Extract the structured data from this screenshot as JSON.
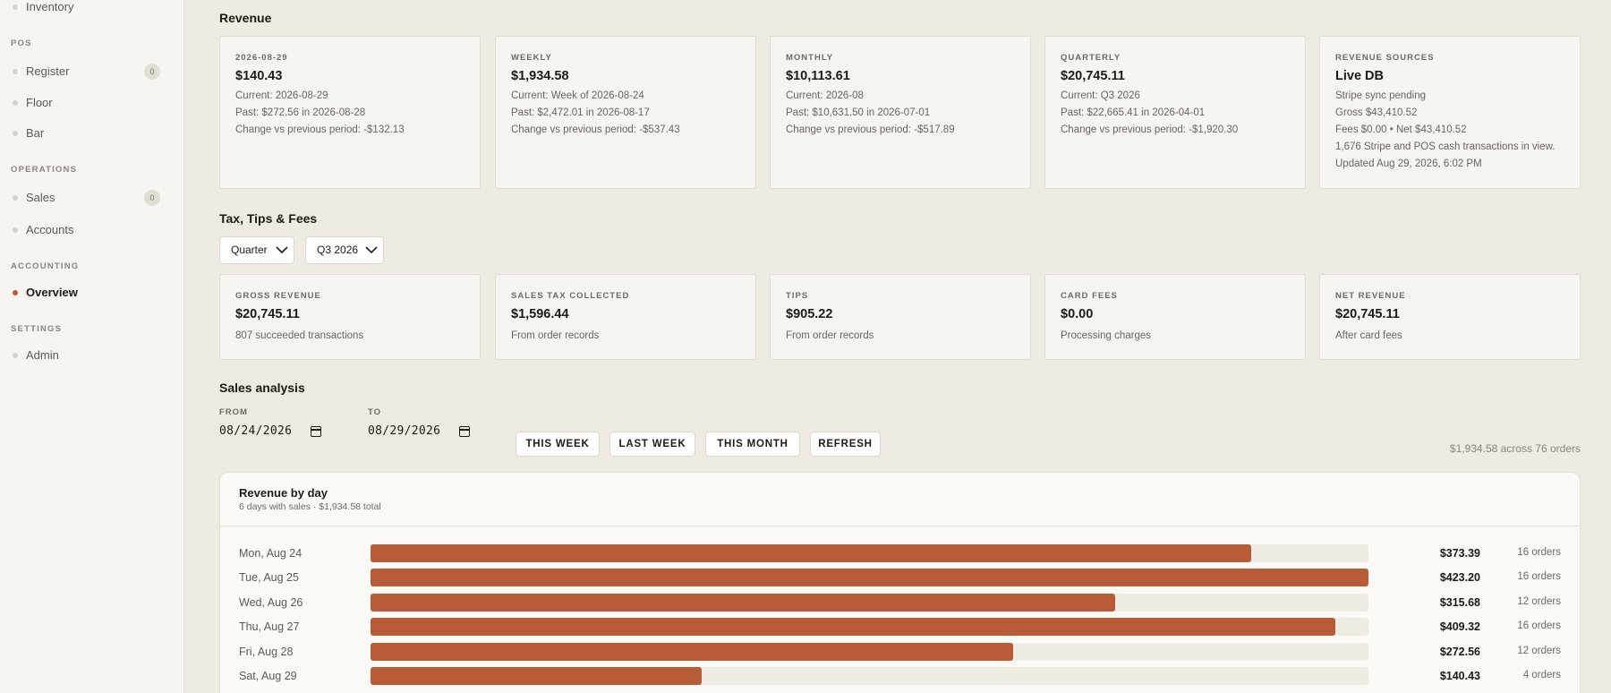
{
  "sidebar": {
    "items": [
      {
        "label": "Inventory",
        "active": false
      },
      {
        "section": "POS"
      },
      {
        "label": "Register",
        "count": "0",
        "active": false
      },
      {
        "label": "Floor",
        "active": false
      },
      {
        "label": "Bar",
        "active": false
      },
      {
        "section": "OPERATIONS"
      },
      {
        "label": "Sales",
        "count": "0",
        "active": false
      },
      {
        "label": "Accounts",
        "active": false
      },
      {
        "section": "ACCOUNTING"
      },
      {
        "label": "Overview",
        "active": true
      },
      {
        "section": "SETTINGS"
      },
      {
        "label": "Admin",
        "active": false
      }
    ]
  },
  "revenue": {
    "title": "Revenue",
    "cards": [
      {
        "kicker": "2026-08-29",
        "value": "$140.43",
        "lines": [
          "Current: 2026-08-29",
          "Past: $272.56 in 2026-08-28",
          "Change vs previous period: -$132.13"
        ]
      },
      {
        "kicker": "WEEKLY",
        "value": "$1,934.58",
        "lines": [
          "Current: Week of 2026-08-24",
          "Past: $2,472.01 in 2026-08-17",
          "Change vs previous period: -$537.43"
        ]
      },
      {
        "kicker": "MONTHLY",
        "value": "$10,113.61",
        "lines": [
          "Current: 2026-08",
          "Past: $10,631.50 in 2026-07-01",
          "Change vs previous period: -$517.89"
        ]
      },
      {
        "kicker": "QUARTERLY",
        "value": "$20,745.11",
        "lines": [
          "Current: Q3 2026",
          "Past: $22,665.41 in 2026-04-01",
          "Change vs previous period: -$1,920.30"
        ]
      },
      {
        "kicker": "REVENUE SOURCES",
        "value": "Live DB",
        "lines": [
          "Stripe sync pending",
          "Gross $43,410.52",
          "Fees $0.00 • Net $43,410.52",
          "1,676 Stripe and POS cash transactions in view.",
          "Updated Aug 29, 2026, 6:02 PM"
        ]
      }
    ]
  },
  "taxes": {
    "title": "Tax, Tips & Fees",
    "period_select": "Quarter",
    "quarter_select": "Q3 2026",
    "cards": [
      {
        "kicker": "GROSS REVENUE",
        "value": "$20,745.11",
        "note": "807 succeeded transactions"
      },
      {
        "kicker": "SALES TAX COLLECTED",
        "value": "$1,596.44",
        "note": "From order records"
      },
      {
        "kicker": "TIPS",
        "value": "$905.22",
        "note": "From order records"
      },
      {
        "kicker": "CARD FEES",
        "value": "$0.00",
        "note": "Processing charges"
      },
      {
        "kicker": "NET REVENUE",
        "value": "$20,745.11",
        "note": "After card fees"
      }
    ]
  },
  "analysis": {
    "title": "Sales analysis",
    "from_label": "FROM",
    "from_value": "08/24/2026",
    "to_label": "TO",
    "to_value": "08/29/2026",
    "buttons": [
      "THIS WEEK",
      "LAST WEEK",
      "THIS MONTH",
      "REFRESH"
    ],
    "summary": "$1,934.58 across 76 orders"
  },
  "panel": {
    "title": "Revenue by day",
    "subtitle": "6 days with sales · $1,934.58 total"
  },
  "colors": {
    "accent": "#b85c38",
    "background": "#efebe2",
    "card": "#f7f5f1"
  },
  "chart_data": {
    "type": "bar",
    "orientation": "horizontal",
    "title": "Revenue by day",
    "categories": [
      "Mon, Aug 24",
      "Tue, Aug 25",
      "Wed, Aug 26",
      "Thu, Aug 27",
      "Fri, Aug 28",
      "Sat, Aug 29"
    ],
    "values": [
      373.39,
      423.2,
      315.68,
      409.32,
      272.56,
      140.43
    ],
    "amount_labels": [
      "$373.39",
      "$423.20",
      "$315.68",
      "$409.32",
      "$272.56",
      "$140.43"
    ],
    "order_labels": [
      "16 orders",
      "16 orders",
      "12 orders",
      "16 orders",
      "12 orders",
      "4 orders"
    ],
    "xlim": [
      0,
      423.2
    ]
  }
}
